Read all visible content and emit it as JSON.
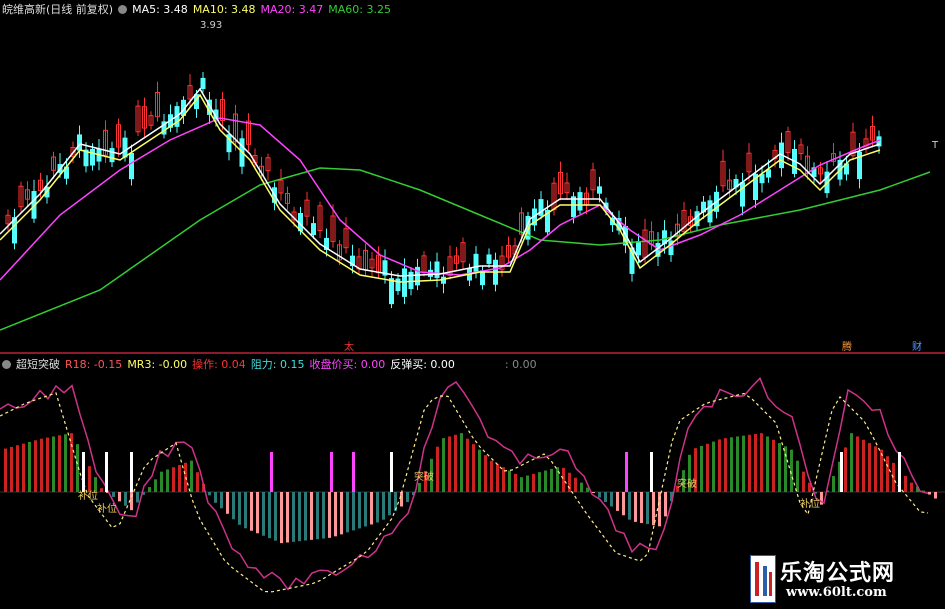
{
  "main_legend": {
    "title": "皖维高新(日线 前复权)",
    "items": [
      {
        "label": "MA5: 3.48",
        "color": "#ffffff"
      },
      {
        "label": "MA10: 3.48",
        "color": "#ffff66"
      },
      {
        "label": "MA20: 3.47",
        "color": "#ff44ff"
      },
      {
        "label": "MA60: 3.25",
        "color": "#33cc33"
      }
    ]
  },
  "main_chart": {
    "high_label": "3.93",
    "corner_labels": [
      "腾",
      "财"
    ],
    "marker_label": "太",
    "t_label": "T"
  },
  "indicator_legend": {
    "title": "超短突破",
    "items": [
      {
        "label": "R18: -0.15",
        "color": "#ff5555"
      },
      {
        "label": "MR3: -0.00",
        "color": "#ffff66"
      },
      {
        "label": "操作: 0.04",
        "color": "#ff3333"
      },
      {
        "label": "阻力: 0.15",
        "color": "#44dddd"
      },
      {
        "label": "收盘价买: 0.00",
        "color": "#ff44ff"
      },
      {
        "label": "反弹买: 0.00",
        "color": "#ffffff"
      }
    ],
    "extra": ": 0.00"
  },
  "indicator_chart": {
    "labels": [
      "补位",
      "补位",
      "突破",
      "突破",
      "补位"
    ]
  },
  "watermark": {
    "title": "乐淘公式网",
    "url": "www.60lt.com"
  },
  "colors": {
    "up": "#ff3333",
    "down": "#55ffff",
    "ma5": "#ffffff",
    "ma10": "#ffff66",
    "ma20": "#ff44ff",
    "ma60": "#33cc33",
    "divider": "#8c1a2a"
  }
}
